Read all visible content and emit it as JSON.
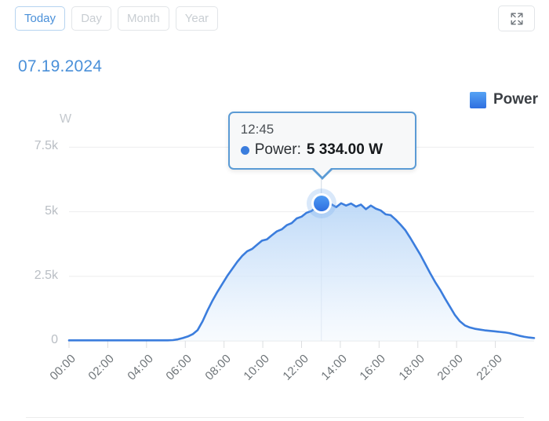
{
  "toolbar": {
    "range_buttons": [
      {
        "label": "Today",
        "active": true
      },
      {
        "label": "Day",
        "active": false
      },
      {
        "label": "Month",
        "active": false
      },
      {
        "label": "Year",
        "active": false
      }
    ],
    "fullscreen_icon": "fullscreen-expand-icon"
  },
  "header": {
    "date": "07.19.2024"
  },
  "legend": {
    "label": "Power",
    "color": "#3b7ddd",
    "icon": "legend-color-swatch"
  },
  "tooltip": {
    "time": "12:45",
    "series": "Power:",
    "value": "5 334.00 W",
    "dot_icon": "series-dot-icon"
  },
  "chart_data": {
    "type": "area",
    "title": "07.19.2024",
    "xlabel": "",
    "ylabel": "W",
    "unit": "W",
    "grid": true,
    "legend_position": "top-right",
    "ylim": [
      0,
      8333
    ],
    "ytick_labels": [
      "0",
      "2.5k",
      "5k",
      "7.5k"
    ],
    "ytick_values": [
      0,
      2500,
      5000,
      7500
    ],
    "xtick_labels": [
      "00:00",
      "02:00",
      "04:00",
      "06:00",
      "08:00",
      "10:00",
      "12:00",
      "14:00",
      "16:00",
      "18:00",
      "20:00",
      "22:00"
    ],
    "xlim_hours": [
      0,
      23.75
    ],
    "highlight": {
      "x": "12:45",
      "y": 5334,
      "label": "5 334.00 W"
    },
    "series": [
      {
        "name": "Power",
        "color": "#3b7ddd",
        "x": [
          "00:00",
          "00:15",
          "00:30",
          "00:45",
          "01:00",
          "01:15",
          "01:30",
          "01:45",
          "02:00",
          "02:15",
          "02:30",
          "02:45",
          "03:00",
          "03:15",
          "03:30",
          "03:45",
          "04:00",
          "04:15",
          "04:30",
          "04:45",
          "05:00",
          "05:15",
          "05:30",
          "05:45",
          "06:00",
          "06:15",
          "06:30",
          "06:45",
          "07:00",
          "07:15",
          "07:30",
          "07:45",
          "08:00",
          "08:15",
          "08:30",
          "08:45",
          "09:00",
          "09:15",
          "09:30",
          "09:45",
          "10:00",
          "10:15",
          "10:30",
          "10:45",
          "11:00",
          "11:15",
          "11:30",
          "11:45",
          "12:00",
          "12:15",
          "12:30",
          "12:45",
          "13:00",
          "13:15",
          "13:30",
          "13:45",
          "14:00",
          "14:15",
          "14:30",
          "14:45",
          "15:00",
          "15:15",
          "15:30",
          "15:45",
          "16:00",
          "16:15",
          "16:30",
          "16:45",
          "17:00",
          "17:15",
          "17:30",
          "17:45",
          "18:00",
          "18:15",
          "18:30",
          "18:45",
          "19:00",
          "19:15",
          "19:30",
          "19:45",
          "20:00",
          "20:15",
          "20:30",
          "20:45",
          "21:00",
          "21:15",
          "21:30",
          "21:45",
          "22:00",
          "22:15",
          "22:30",
          "22:45",
          "23:00",
          "23:15",
          "23:30",
          "23:45"
        ],
        "values": [
          20,
          20,
          20,
          20,
          20,
          20,
          20,
          20,
          20,
          20,
          20,
          20,
          20,
          20,
          20,
          20,
          20,
          20,
          20,
          20,
          20,
          30,
          60,
          110,
          170,
          260,
          420,
          760,
          1180,
          1560,
          1900,
          2210,
          2520,
          2790,
          3060,
          3290,
          3470,
          3560,
          3720,
          3880,
          3930,
          4090,
          4240,
          4320,
          4480,
          4560,
          4740,
          4810,
          4960,
          5030,
          5180,
          5334,
          5150,
          5290,
          5180,
          5330,
          5240,
          5320,
          5200,
          5280,
          5100,
          5240,
          5120,
          5050,
          4900,
          4870,
          4700,
          4500,
          4280,
          3980,
          3660,
          3340,
          2980,
          2620,
          2280,
          1980,
          1640,
          1320,
          1000,
          760,
          600,
          520,
          470,
          440,
          410,
          390,
          370,
          350,
          330,
          300,
          250,
          200,
          160,
          130,
          110
        ]
      }
    ]
  },
  "axis": {
    "y_unit": "W"
  }
}
